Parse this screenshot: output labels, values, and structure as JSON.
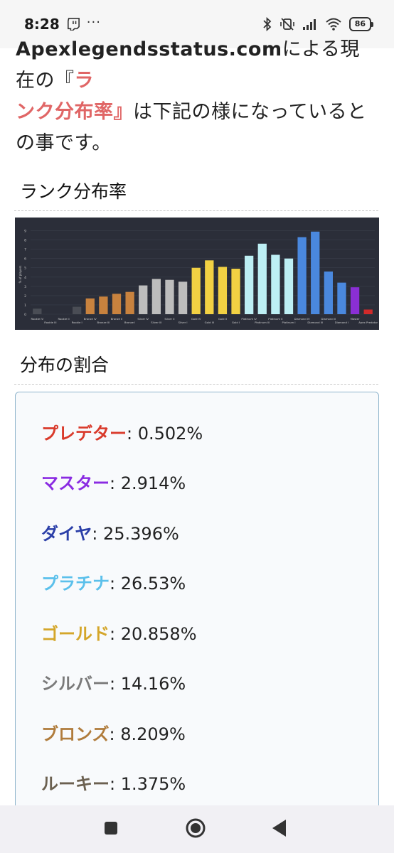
{
  "status_bar": {
    "time": "8:28",
    "battery": "86",
    "more": "···"
  },
  "article": {
    "intro_source": "Apexlegendsstatus.com",
    "intro_mid": "による現在の『",
    "intro_highlight_a": "ラ",
    "intro_highlight_b": "ンク分布率』",
    "intro_rest": "は下記の様になっているとの事です。"
  },
  "sections": {
    "rank_dist_heading": "ランク分布率",
    "ratio_heading": "分布の割合"
  },
  "chart_data": {
    "type": "bar",
    "ylabel": "% of players",
    "yticks": [
      "0",
      "1",
      "2",
      "3",
      "4",
      "5",
      "6",
      "7",
      "8",
      "9"
    ],
    "ylim": [
      0,
      9.5
    ],
    "categories": [
      "Rookie IV",
      "Rookie III",
      "Rookie II",
      "Rookie I",
      "Bronze IV",
      "Bronze III",
      "Bronze II",
      "Bronze I",
      "Silver IV",
      "Silver III",
      "Silver II",
      "Silver I",
      "Gold IV",
      "Gold III",
      "Gold II",
      "Gold I",
      "Platinum IV",
      "Platinum III",
      "Platinum II",
      "Platinum I",
      "Diamond IV",
      "Diamond III",
      "Diamond II",
      "Diamond I",
      "Master",
      "Apex Predator"
    ],
    "values": [
      0.6,
      0.0,
      0.0,
      0.8,
      1.7,
      1.9,
      2.2,
      2.4,
      3.1,
      3.8,
      3.7,
      3.5,
      5.0,
      5.8,
      5.1,
      4.9,
      6.3,
      7.6,
      6.4,
      6.0,
      8.3,
      8.9,
      4.6,
      3.4,
      2.9,
      0.5
    ],
    "colors": [
      "#4a4d55",
      "#4a4d55",
      "#4a4d55",
      "#4a4d55",
      "#c8823e",
      "#c8823e",
      "#c8823e",
      "#c8823e",
      "#bdbdbd",
      "#bdbdbd",
      "#bdbdbd",
      "#bdbdbd",
      "#f2d143",
      "#f2d143",
      "#f2d143",
      "#f2d143",
      "#bdeff4",
      "#bdeff4",
      "#bdeff4",
      "#bdeff4",
      "#4a88de",
      "#4a88de",
      "#4a88de",
      "#4a88de",
      "#8a2fd4",
      "#d12a2a"
    ]
  },
  "distribution": [
    {
      "rank": "プレデター",
      "value": ": 0.502%",
      "color": "#d93a2b"
    },
    {
      "rank": "マスター",
      "value": ": 2.914%",
      "color": "#8a2be2"
    },
    {
      "rank": "ダイヤ",
      "value": ": 25.396%",
      "color": "#2b3fa8"
    },
    {
      "rank": "プラチナ",
      "value": ": 26.53%",
      "color": "#5bc0eb"
    },
    {
      "rank": "ゴールド",
      "value": ": 20.858%",
      "color": "#d4a62a"
    },
    {
      "rank": "シルバー",
      "value": ": 14.16%",
      "color": "#7a7a7a"
    },
    {
      "rank": "ブロンズ",
      "value": ": 8.209%",
      "color": "#b07c3c"
    },
    {
      "rank": "ルーキー",
      "value": ": 1.375%",
      "color": "#6b6050"
    }
  ],
  "nav": {
    "recent": "recents",
    "home": "home",
    "back": "back"
  }
}
